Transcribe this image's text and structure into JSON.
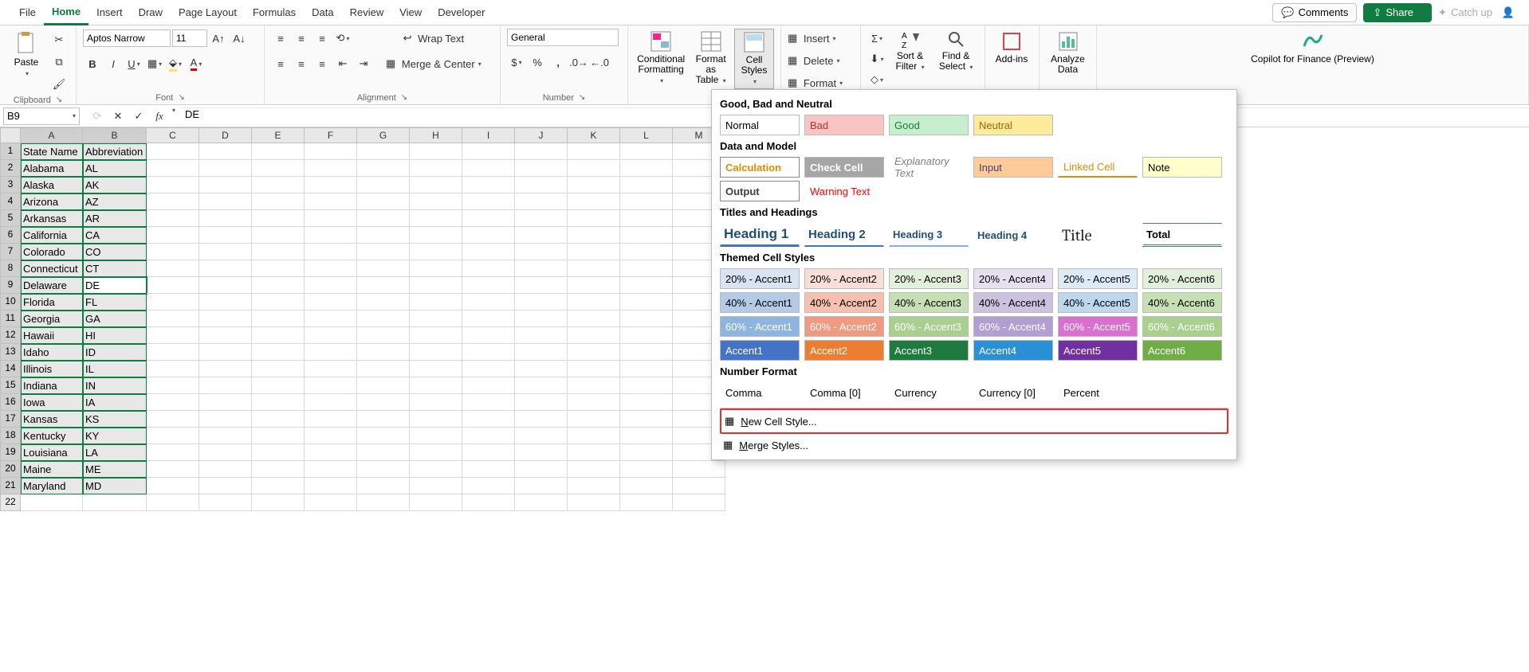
{
  "tabs": [
    "File",
    "Home",
    "Insert",
    "Draw",
    "Page Layout",
    "Formulas",
    "Data",
    "Review",
    "View",
    "Developer"
  ],
  "active_tab": "Home",
  "tabs_right": {
    "comments": "Comments",
    "share": "Share",
    "catchup": "Catch up"
  },
  "ribbon": {
    "clipboard": {
      "label": "Clipboard",
      "paste": "Paste"
    },
    "font": {
      "label": "Font",
      "name": "Aptos Narrow",
      "size": "11"
    },
    "alignment": {
      "label": "Alignment",
      "wrap": "Wrap Text",
      "merge": "Merge & Center"
    },
    "number": {
      "label": "Number",
      "format": "General"
    },
    "styles": {
      "cond": "Conditional Formatting",
      "table": "Format as Table",
      "cell": "Cell Styles"
    },
    "cells": {
      "insert": "Insert",
      "delete": "Delete",
      "format": "Format"
    },
    "editing": {
      "sort": "Sort & Filter",
      "find": "Find & Select"
    },
    "addins": {
      "label": "Add-ins"
    },
    "analyze": {
      "label": "Analyze Data"
    },
    "copilot": {
      "label": "Copilot for Finance (Preview)"
    }
  },
  "formula_bar": {
    "name_box": "B9",
    "value": "DE"
  },
  "grid": {
    "columns": [
      "A",
      "B",
      "C",
      "D",
      "E",
      "F",
      "G",
      "H",
      "I",
      "J",
      "K",
      "L",
      "M"
    ],
    "headers": [
      "State Name",
      "Abbreviation"
    ],
    "rows": [
      [
        "Alabama",
        "AL"
      ],
      [
        "Alaska",
        "AK"
      ],
      [
        "Arizona",
        "AZ"
      ],
      [
        "Arkansas",
        "AR"
      ],
      [
        "California",
        "CA"
      ],
      [
        "Colorado",
        "CO"
      ],
      [
        "Connecticut",
        "CT"
      ],
      [
        "Delaware",
        "DE"
      ],
      [
        "Florida",
        "FL"
      ],
      [
        "Georgia",
        "GA"
      ],
      [
        "Hawaii",
        "HI"
      ],
      [
        "Idaho",
        "ID"
      ],
      [
        "Illinois",
        "IL"
      ],
      [
        "Indiana",
        "IN"
      ],
      [
        "Iowa",
        "IA"
      ],
      [
        "Kansas",
        "KS"
      ],
      [
        "Kentucky",
        "KY"
      ],
      [
        "Louisiana",
        "LA"
      ],
      [
        "Maine",
        "ME"
      ],
      [
        "Maryland",
        "MD"
      ]
    ],
    "active_cell": "B9"
  },
  "styles_panel": {
    "sec1": {
      "title": "Good, Bad and Neutral",
      "items": [
        {
          "name": "Normal",
          "bg": "#ffffff",
          "fg": "#000"
        },
        {
          "name": "Bad",
          "bg": "#f8c4c4",
          "fg": "#bd2f2f"
        },
        {
          "name": "Good",
          "bg": "#c6efce",
          "fg": "#1e7b34"
        },
        {
          "name": "Neutral",
          "bg": "#ffeb9c",
          "fg": "#9c6500"
        }
      ]
    },
    "sec2": {
      "title": "Data and Model",
      "row1": [
        {
          "name": "Calculation",
          "bg": "#ffffff",
          "fg": "#e08c00",
          "bold": true,
          "border": "#888"
        },
        {
          "name": "Check Cell",
          "bg": "#a6a6a6",
          "fg": "#ffffff",
          "bold": true
        },
        {
          "name": "Explanatory Text",
          "bg": "#ffffff",
          "fg": "#7f7f7f",
          "italic": true,
          "noborder": true
        },
        {
          "name": "Input",
          "bg": "#ffcc99",
          "fg": "#3f3f76"
        },
        {
          "name": "Linked Cell",
          "bg": "#ffffff",
          "fg": "#e08c00",
          "noborder": true,
          "underline": "#e08c00"
        },
        {
          "name": "Note",
          "bg": "#ffffcc",
          "fg": "#000"
        }
      ],
      "row2": [
        {
          "name": "Output",
          "bg": "#ffffff",
          "fg": "#3f3f3f",
          "bold": true,
          "border": "#888"
        },
        {
          "name": "Warning Text",
          "bg": "#ffffff",
          "fg": "#ff0000",
          "noborder": true
        }
      ]
    },
    "sec3": {
      "title": "Titles and Headings",
      "items": [
        {
          "name": "Heading 1",
          "cls": "h1"
        },
        {
          "name": "Heading 2",
          "cls": "h2"
        },
        {
          "name": "Heading 3",
          "cls": "h3"
        },
        {
          "name": "Heading 4",
          "cls": "h4"
        },
        {
          "name": "Title",
          "cls": "title"
        },
        {
          "name": "Total",
          "cls": "total"
        }
      ]
    },
    "sec4": {
      "title": "Themed Cell Styles",
      "rows": [
        [
          {
            "name": "20% - Accent1",
            "bg": "#d8e4f2"
          },
          {
            "name": "20% - Accent2",
            "bg": "#fadfd8"
          },
          {
            "name": "20% - Accent3",
            "bg": "#e2efda"
          },
          {
            "name": "20% - Accent4",
            "bg": "#e6dff0"
          },
          {
            "name": "20% - Accent5",
            "bg": "#ddebf7"
          },
          {
            "name": "20% - Accent6",
            "bg": "#e2efda"
          }
        ],
        [
          {
            "name": "40% - Accent1",
            "bg": "#b4cbe8"
          },
          {
            "name": "40% - Accent2",
            "bg": "#f6bfaf"
          },
          {
            "name": "40% - Accent3",
            "bg": "#c6e0b4"
          },
          {
            "name": "40% - Accent4",
            "bg": "#ccc2e0"
          },
          {
            "name": "40% - Accent5",
            "bg": "#bdd7ee"
          },
          {
            "name": "40% - Accent6",
            "bg": "#c6e0b4"
          }
        ],
        [
          {
            "name": "60% - Accent1",
            "bg": "#8eb4e0",
            "fg": "#fff"
          },
          {
            "name": "60% - Accent2",
            "bg": "#f19a82",
            "fg": "#fff"
          },
          {
            "name": "60% - Accent3",
            "bg": "#a9d08e",
            "fg": "#fff"
          },
          {
            "name": "60% - Accent4",
            "bg": "#b09fd0",
            "fg": "#fff"
          },
          {
            "name": "60% - Accent5",
            "bg": "#da6fcf",
            "fg": "#fff"
          },
          {
            "name": "60% - Accent6",
            "bg": "#a9d08e",
            "fg": "#fff"
          }
        ],
        [
          {
            "name": "Accent1",
            "bg": "#4472c4",
            "fg": "#fff"
          },
          {
            "name": "Accent2",
            "bg": "#ed7d31",
            "fg": "#fff"
          },
          {
            "name": "Accent3",
            "bg": "#1f7a3f",
            "fg": "#fff"
          },
          {
            "name": "Accent4",
            "bg": "#2a8fd4",
            "fg": "#fff"
          },
          {
            "name": "Accent5",
            "bg": "#7030a0",
            "fg": "#fff"
          },
          {
            "name": "Accent6",
            "bg": "#70ad47",
            "fg": "#fff"
          }
        ]
      ]
    },
    "sec5": {
      "title": "Number Format",
      "items": [
        "Comma",
        "Comma [0]",
        "Currency",
        "Currency [0]",
        "Percent"
      ]
    },
    "footer": {
      "new": "New Cell Style...",
      "merge": "Merge Styles..."
    }
  }
}
